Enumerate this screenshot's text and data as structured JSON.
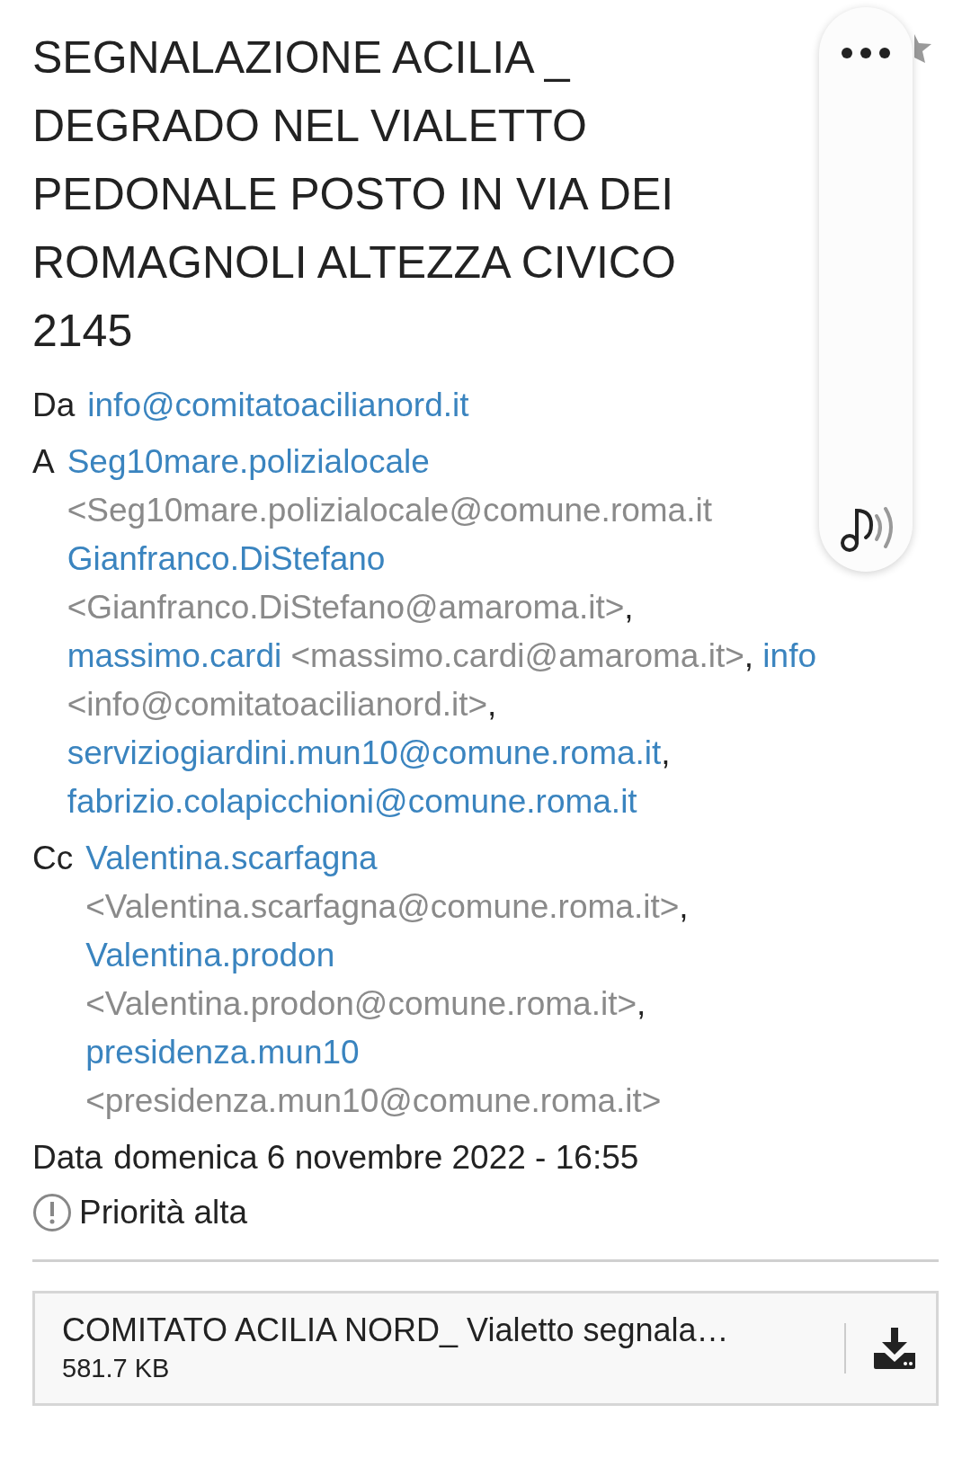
{
  "subject": "SEGNALAZIONE ACILIA _ DEGRADO NEL VIALETTO PEDONALE POSTO IN VIA DEI ROMAGNOLI ALTEZZA CIVICO 2145",
  "from": {
    "label": "Da",
    "address": "info@comitatoacilianord.it"
  },
  "to": {
    "label": "A",
    "recipients": [
      {
        "name": "Seg10mare.polizialocale",
        "address": "<Seg10mare.polizialocale@comune.roma.it"
      },
      {
        "name": "Gianfranco.DiStefano",
        "address": "<Gianfranco.DiStefano@amaroma.it>",
        "separator": ","
      },
      {
        "name": "massimo.cardi",
        "address": "<massimo.cardi@amaroma.it>",
        "separator": ","
      },
      {
        "name": "info",
        "address": "<info@comitatoacilianord.it>",
        "separator": ","
      },
      {
        "name": "serviziogiardini.mun10@comune.roma.it",
        "separator": ","
      },
      {
        "name": "fabrizio.colapicchioni@comune.roma.it"
      }
    ]
  },
  "cc": {
    "label": "Cc",
    "recipients": [
      {
        "name": "Valentina.scarfagna",
        "address": "<Valentina.scarfagna@comune.roma.it>",
        "separator": ","
      },
      {
        "name": "Valentina.prodon",
        "address": "<Valentina.prodon@comune.roma.it>",
        "separator": ","
      },
      {
        "name": "presidenza.mun10",
        "address": "<presidenza.mun10@comune.roma.it>"
      }
    ]
  },
  "date": {
    "label": "Data",
    "value": "domenica 6 novembre 2022 - 16:55"
  },
  "priority": {
    "label": "Priorità alta"
  },
  "attachment": {
    "name": "COMITATO ACILIA NORD_ Vialetto segnala…",
    "size": "581.7 KB"
  }
}
